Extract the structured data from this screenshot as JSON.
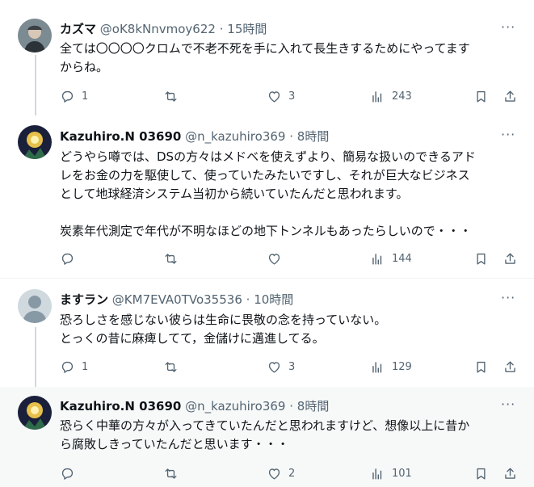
{
  "tweets": [
    {
      "name": "カズマ",
      "handle": "@oK8kNnvmoy622",
      "time": "15時間",
      "text": "全ては〇〇〇〇クロムで不老不死を手に入れて長生きするためにやってます\nからね。",
      "reply_count": "1",
      "retweet_count": "",
      "like_count": "3",
      "view_count": "243"
    },
    {
      "name": "Kazuhiro.N 03690",
      "handle": "@n_kazuhiro369",
      "time": "8時間",
      "text": "どうやら噂では、DSの方々はメドベを使えずより、簡易な扱いのできるアド\nレをお金の力を駆使して、使っていたみたいですし、それが巨大なビジネス\nとして地球経済システム当初から続いていたんだと思われます。\n\n炭素年代測定で年代が不明なほどの地下トンネルもあったらしいので・・・",
      "reply_count": "",
      "retweet_count": "",
      "like_count": "",
      "view_count": "144"
    },
    {
      "name": "ますラン",
      "handle": "@KM7EVA0TVo35536",
      "time": "10時間",
      "text": "恐ろしさを感じない彼らは生命に畏敬の念を持っていない。\nとっくの昔に麻痺してて，金儲けに邁進してる。",
      "reply_count": "1",
      "retweet_count": "",
      "like_count": "3",
      "view_count": "129"
    },
    {
      "name": "Kazuhiro.N 03690",
      "handle": "@n_kazuhiro369",
      "time": "8時間",
      "text": "恐らく中華の方々が入ってきていたんだと思われますけど、想像以上に昔か\nら腐敗しきっていたんだと思います・・・",
      "reply_count": "",
      "retweet_count": "",
      "like_count": "2",
      "view_count": "101"
    }
  ],
  "more_label": "···",
  "dot": "·",
  "colors": {
    "text": "#0f1419",
    "muted": "#536471",
    "line": "#cfd9de"
  },
  "icons": [
    "reply-icon",
    "retweet-icon",
    "like-icon",
    "views-icon",
    "bookmark-icon",
    "share-icon",
    "more-icon"
  ]
}
